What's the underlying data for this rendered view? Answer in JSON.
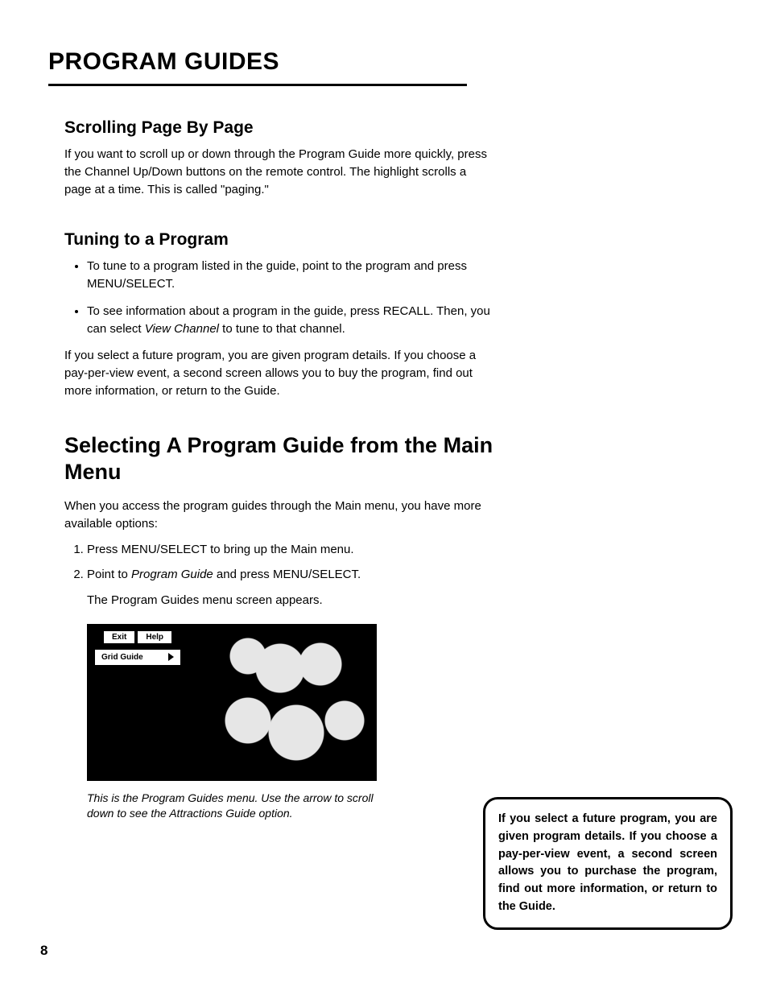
{
  "chapter_title": "PROGRAM GUIDES",
  "section1": {
    "heading": "Scrolling Page By Page",
    "body": "If you want to scroll up or down through the Program Guide more quickly, press the Channel Up/Down buttons on the remote control. The highlight scrolls a page at a time. This is called \"paging.\""
  },
  "section2": {
    "heading": "Tuning to a Program",
    "bullets": [
      "To tune to a program listed in the guide, point to the program and press MENU/SELECT.",
      "To see information about a program in the guide, press RECALL. Then, you can select View Channel to tune to that channel."
    ],
    "body_after": "If you select a future program, you are given program details. If you choose a pay-per-view event, a second screen allows you to buy the program, find out more information, or return to the Guide."
  },
  "section3": {
    "heading": "Selecting A Program Guide from the Main Menu",
    "intro": "When you access the program guides through the Main menu, you have more available options:",
    "steps": [
      "Press MENU/SELECT to bring up the Main menu.",
      "Point to Program Guide and press MENU/SELECT."
    ],
    "step_follow": "The Program Guides menu screen appears.",
    "screenshot": {
      "tab_exit": "Exit",
      "tab_help": "Help",
      "item_grid": "Grid Guide"
    },
    "caption": "This is the Program Guides menu. Use the arrow to scroll down to see the Attractions Guide option."
  },
  "sidebar": "If you select a future program, you are given program details. If you choose a pay-per-view event, a second screen allows you to purchase the program, find out more information, or return to the Guide.",
  "page_number": "8"
}
